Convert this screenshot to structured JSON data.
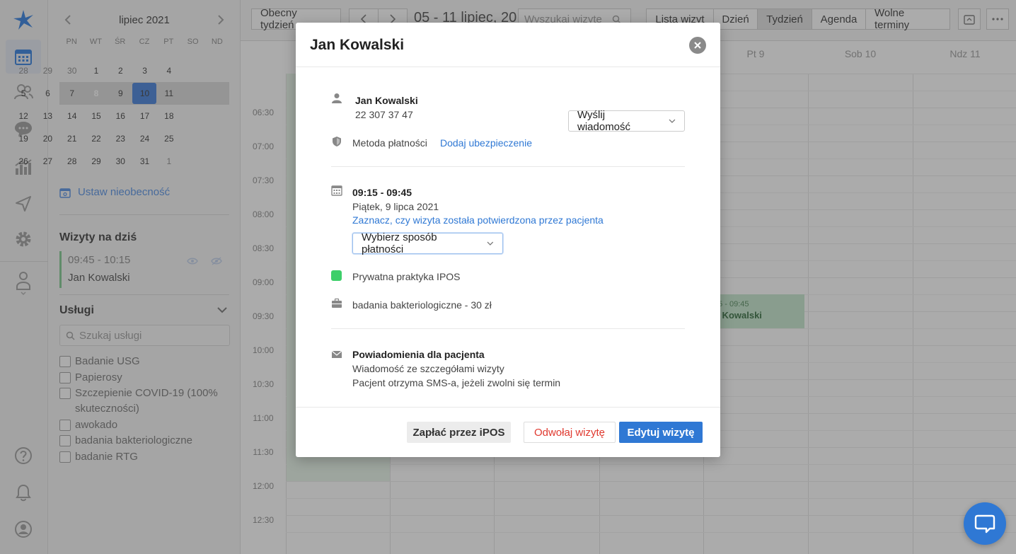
{
  "sidebar": {
    "mini_calendar": {
      "month": "lipiec 2021",
      "weekdays": [
        "PN",
        "WT",
        "ŚR",
        "CZ",
        "PT",
        "SO",
        "ND"
      ],
      "days": [
        "28",
        "29",
        "30",
        "1",
        "2",
        "3",
        "4",
        "5",
        "6",
        "7",
        "8",
        "9",
        "10",
        "11",
        "12",
        "13",
        "14",
        "15",
        "16",
        "17",
        "18",
        "19",
        "20",
        "21",
        "22",
        "23",
        "24",
        "25",
        "26",
        "27",
        "28",
        "29",
        "30",
        "31",
        "1"
      ],
      "today": "8"
    },
    "absence_label": "Ustaw nieobecność",
    "today_visits_title": "Wizyty na dziś",
    "today_visit": {
      "time": "09:45 - 10:15",
      "patient": "Jan Kowalski"
    },
    "services_title": "Usługi",
    "services_search_placeholder": "Szukaj usługi",
    "services": [
      "Badanie USG",
      "Papierosy",
      "Szczepienie COVID-19 (100% skuteczności)",
      "awokado",
      "badania bakteriologiczne",
      "badanie RTG"
    ]
  },
  "topbar": {
    "current_week": "Obecny tydzień",
    "range_title": "05 - 11 lipiec, 20...",
    "search_placeholder": "Wyszukaj wizyte",
    "views": [
      "Lista wizyt",
      "Dzień",
      "Tydzień",
      "Agenda",
      "Wolne terminy"
    ],
    "active_view": "Tydzień"
  },
  "calendar": {
    "visible_days": [
      "Pt 9",
      "Sob 10",
      "Ndz 11"
    ],
    "times": [
      "06:30",
      "07:00",
      "07:30",
      "08:00",
      "08:30",
      "09:00",
      "09:30",
      "10:00",
      "10:30",
      "11:00",
      "11:30",
      "12:00",
      "12:30"
    ],
    "event": {
      "time": "15 - 09:45",
      "patient": "n Kowalski"
    }
  },
  "modal": {
    "title": "Jan Kowalski",
    "patient_name": "Jan Kowalski",
    "patient_phone": "22 307 37 47",
    "send_message_label": "Wyślij wiadomość",
    "payment_method_label": "Metoda płatności",
    "add_insurance_link": "Dodaj ubezpieczenie",
    "visit_time": "09:15 - 09:45",
    "visit_date": "Piątek, 9 lipca 2021",
    "confirm_link": "Zaznacz, czy wizyta została potwierdzona przez pacjenta",
    "payment_select_label": "Wybierz sposób płatności",
    "practice": "Prywatna praktyka IPOS",
    "practice_color": "#3ecf6a",
    "service": "badania bakteriologiczne - 30 zł",
    "notifications_title": "Powiadomienia dla pacjenta",
    "notification_1": "Wiadomość ze szczegółami wizyty",
    "notification_2": "Pacjent otrzyma SMS-a, jeżeli zwolni się termin",
    "btn_pay_ipos": "Zapłać przez iPOS",
    "btn_cancel": "Odwołaj wizytę",
    "btn_edit": "Edytuj wizytę"
  },
  "colors": {
    "accent": "#2f78d4",
    "danger": "#e0392f"
  }
}
